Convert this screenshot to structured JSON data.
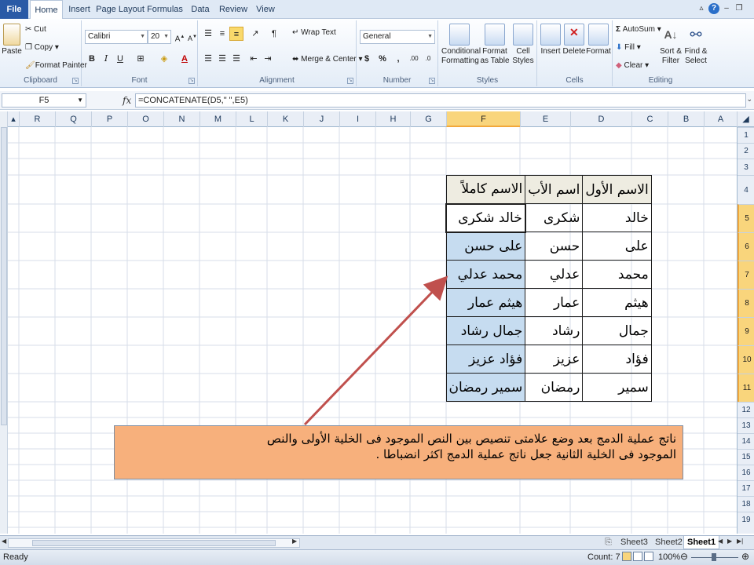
{
  "tabs": [
    "File",
    "Home",
    "Insert",
    "Page Layout",
    "Formulas",
    "Data",
    "Review",
    "View"
  ],
  "ribbon": {
    "clipboard": {
      "paste": "Paste",
      "cut": "Cut",
      "copy": "Copy",
      "format_painter": "Format Painter",
      "label": "Clipboard"
    },
    "font": {
      "name": "Calibri",
      "size": "20",
      "label": "Font",
      "bold": "B",
      "italic": "I",
      "underline": "U"
    },
    "alignment": {
      "wrap_text": "Wrap Text",
      "merge_center": "Merge & Center",
      "label": "Alignment"
    },
    "number": {
      "format": "General",
      "currency": "$",
      "percent": "%",
      "comma": ",",
      "label": "Number"
    },
    "styles": {
      "conditional": "Conditional",
      "conditional2": "Formatting",
      "format_table": "Format",
      "format_table2": "as Table",
      "cell_styles": "Cell",
      "cell_styles2": "Styles",
      "label": "Styles"
    },
    "cells": {
      "insert": "Insert",
      "delete": "Delete",
      "format": "Format",
      "label": "Cells"
    },
    "editing": {
      "autosum": "AutoSum",
      "fill": "Fill",
      "clear": "Clear",
      "sort": "Sort &",
      "sort2": "Filter",
      "find": "Find &",
      "find2": "Select",
      "label": "Editing"
    }
  },
  "formula_bar": {
    "name_box": "F5",
    "fx": "fx",
    "formula": "=CONCATENATE(D5,\" \",E5)"
  },
  "columns": [
    "R",
    "Q",
    "P",
    "O",
    "N",
    "M",
    "L",
    "K",
    "J",
    "I",
    "H",
    "G",
    "F",
    "E",
    "D",
    "C",
    "B",
    "A"
  ],
  "rows": [
    "1",
    "2",
    "3",
    "4",
    "5",
    "6",
    "7",
    "8",
    "9",
    "10",
    "11",
    "12",
    "13",
    "14",
    "15",
    "16",
    "17",
    "18",
    "19"
  ],
  "table": {
    "headers": [
      "الاسم الأول",
      "اسم الأب",
      "الاسم كاملاً"
    ],
    "rows": [
      [
        "خالد",
        "شكرى",
        "خالد شكرى"
      ],
      [
        "على",
        "حسن",
        "على حسن"
      ],
      [
        "محمد",
        "عدلي",
        "محمد عدلي"
      ],
      [
        "هيثم",
        "عمار",
        "هيثم عمار"
      ],
      [
        "جمال",
        "رشاد",
        "جمال رشاد"
      ],
      [
        "فؤاد",
        "عزيز",
        "فؤاد عزيز"
      ],
      [
        "سمير",
        "رمضان",
        "سمير رمضان"
      ]
    ]
  },
  "callout": {
    "line1": "ناتج عملية الدمج بعد وضع علامتى تنصيص بين النص الموجود فى الخلية الأولى والنص",
    "line2": "الموجود فى الخلية الثانية جعل ناتج عملية الدمج اكثر انضباطا ."
  },
  "sheets": [
    "Sheet3",
    "Sheet2",
    "Sheet1"
  ],
  "status": {
    "ready": "Ready",
    "count": "Count: 7",
    "zoom": "100%"
  },
  "colors": {
    "selection": "#c6dcf0",
    "callout": "#f7b07c",
    "header_fill": "#eeece1",
    "arrow": "#c0504d"
  }
}
